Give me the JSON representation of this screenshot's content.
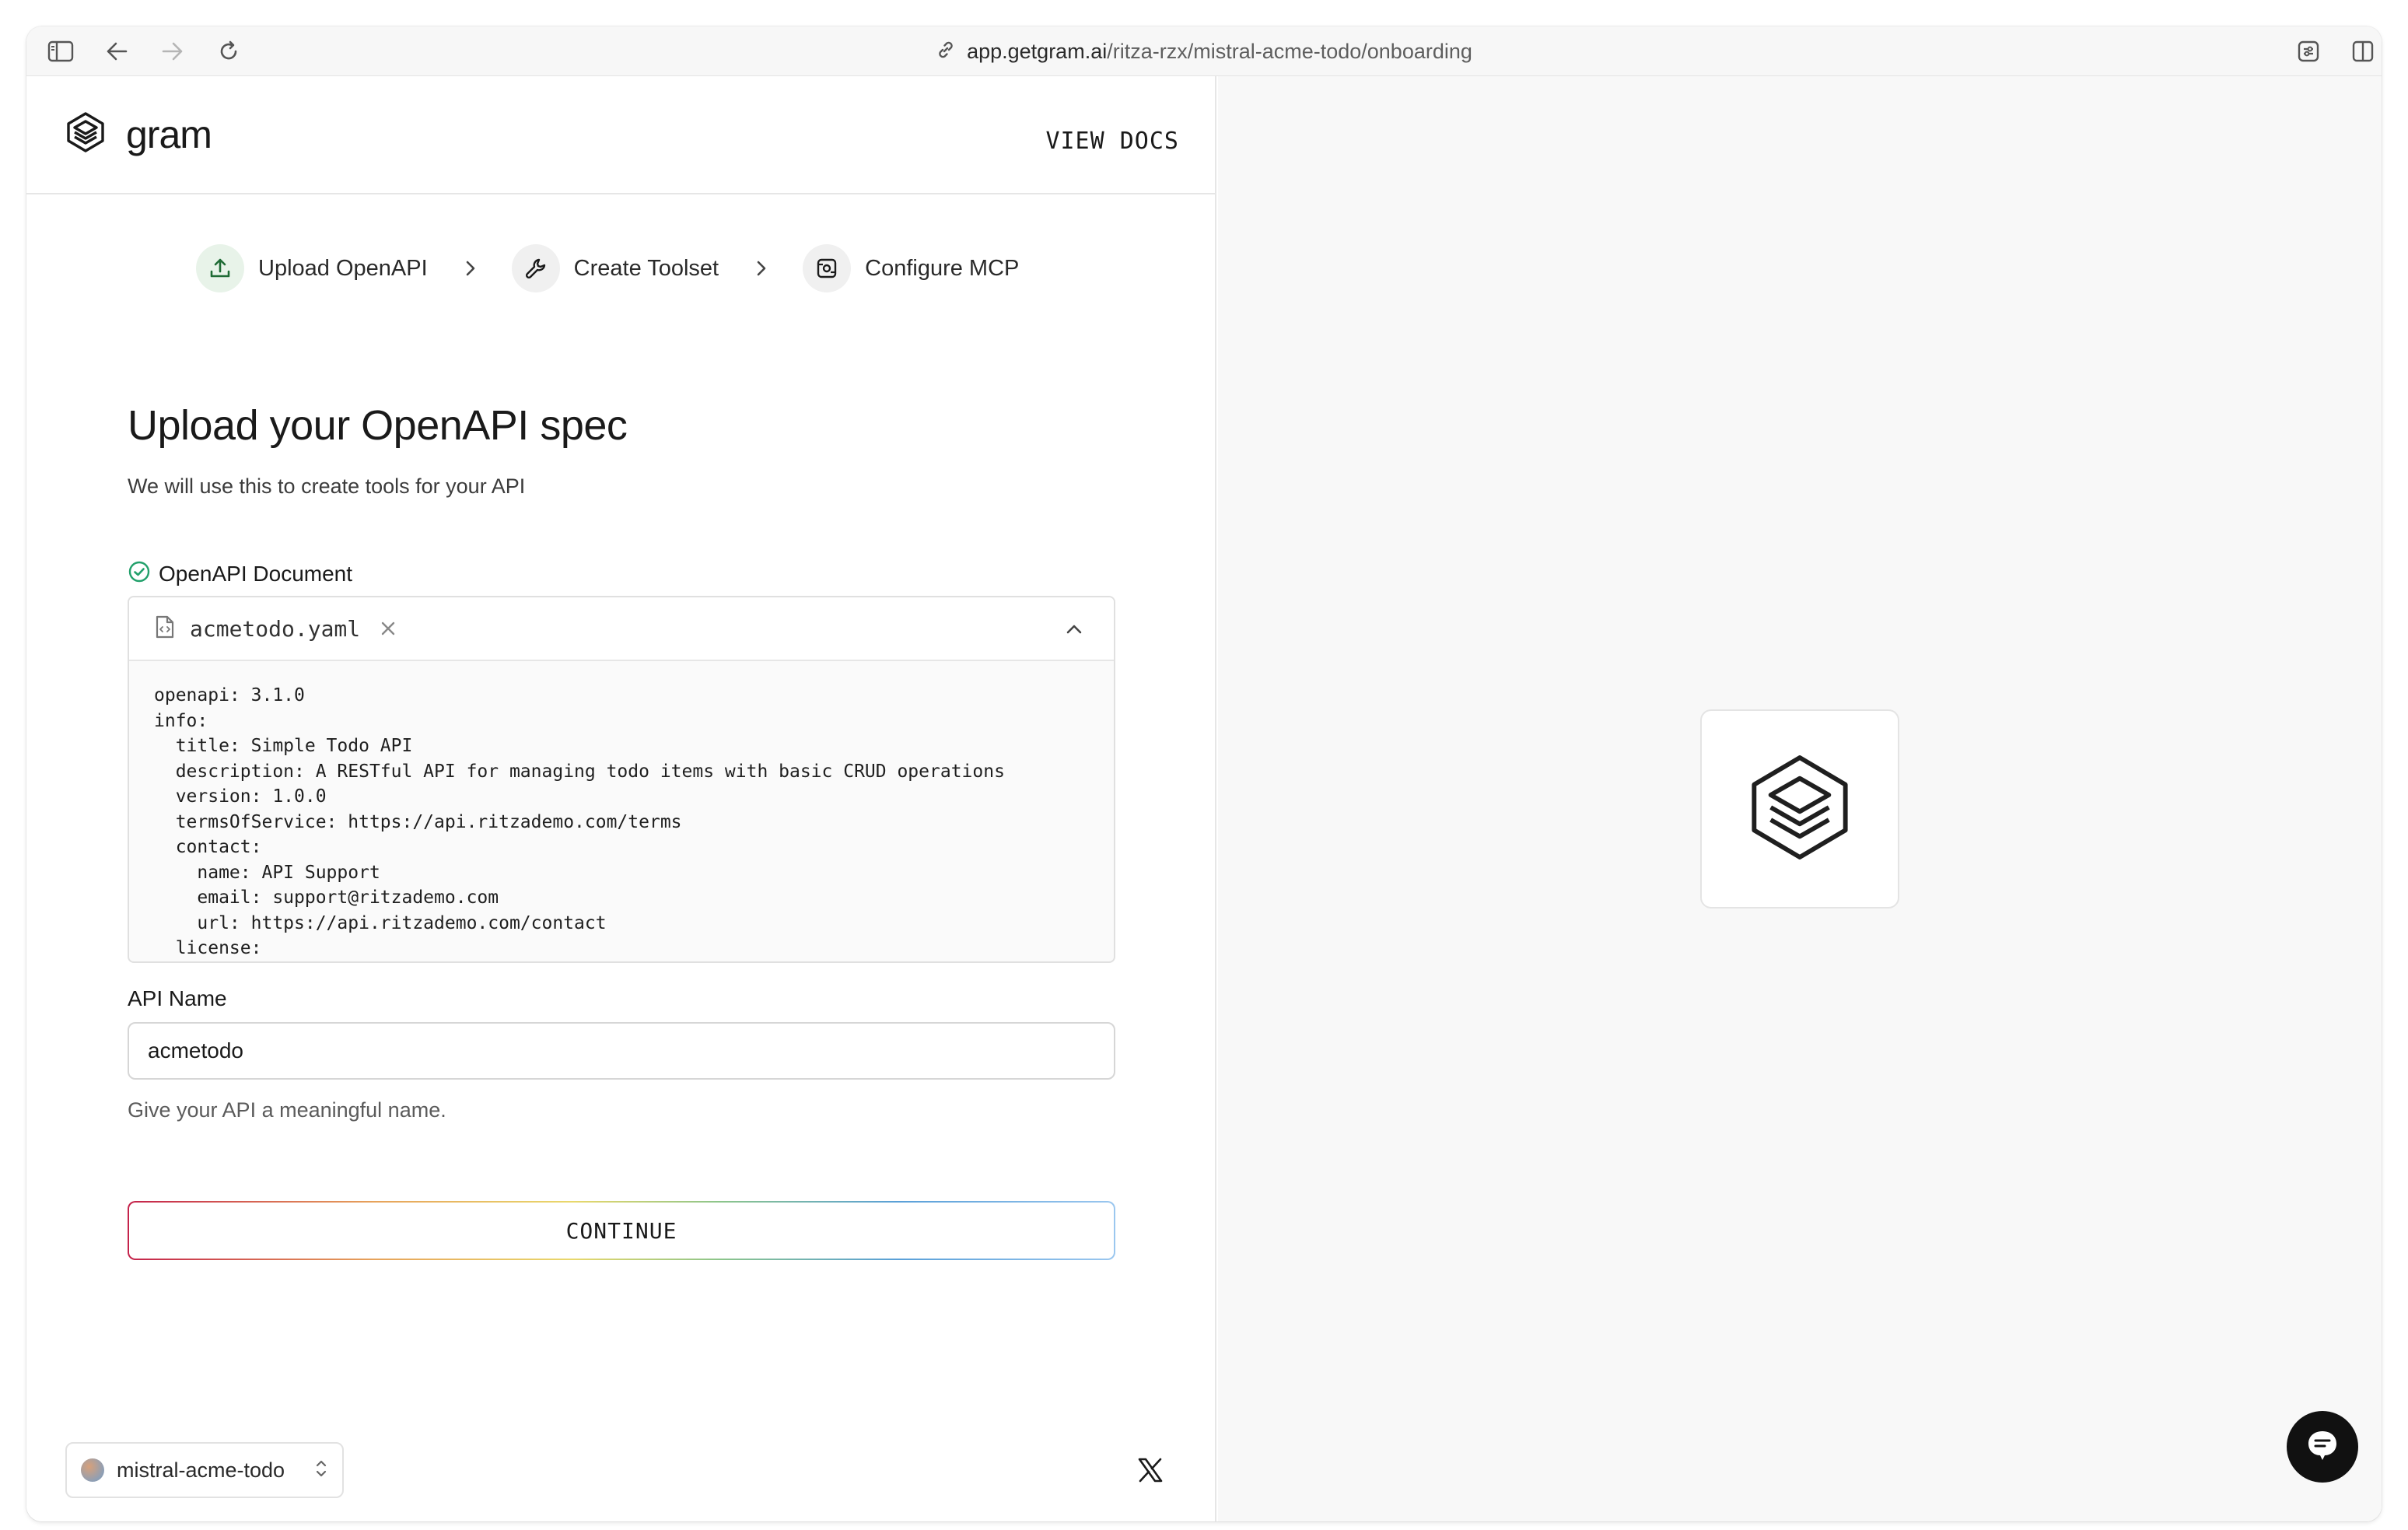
{
  "browser": {
    "url_host": "app.getgram.ai",
    "url_path": "/ritza-rzx/mistral-acme-todo/onboarding"
  },
  "header": {
    "brand": "gram",
    "docs_link": "VIEW DOCS"
  },
  "stepper": {
    "steps": [
      {
        "label": "Upload OpenAPI",
        "icon": "upload-icon",
        "active": true
      },
      {
        "label": "Create Toolset",
        "icon": "wrench-icon",
        "active": false
      },
      {
        "label": "Configure MCP",
        "icon": "mcp-icon",
        "active": false
      }
    ]
  },
  "main": {
    "title": "Upload your OpenAPI spec",
    "subtitle": "We will use this to create tools for your API",
    "document_label": "OpenAPI Document",
    "file": {
      "name": "acmetodo.yaml",
      "content_lines": [
        "openapi: 3.1.0",
        "info:",
        "  title: Simple Todo API",
        "  description: A RESTful API for managing todo items with basic CRUD operations",
        "  version: 1.0.0",
        "  termsOfService: https://api.ritzademo.com/terms",
        "  contact:",
        "    name: API Support",
        "    email: support@ritzademo.com",
        "    url: https://api.ritzademo.com/contact",
        "  license:"
      ]
    },
    "api_name_label": "API Name",
    "api_name_value": "acmetodo",
    "api_name_helper": "Give your API a meaningful name.",
    "continue_label": "CONTINUE"
  },
  "footer": {
    "project_name": "mistral-acme-todo"
  },
  "colors": {
    "success": "#22a06b",
    "step_active_bg": "#e8f3e9",
    "right_pane_bg": "#f8f8f8"
  }
}
